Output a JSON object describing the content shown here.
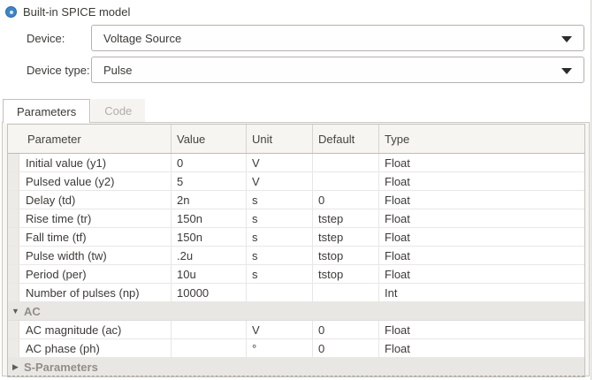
{
  "model_source": {
    "radio_label": "Built-in SPICE model",
    "selected": true
  },
  "fields": {
    "device": {
      "label": "Device:",
      "value": "Voltage Source"
    },
    "device_type": {
      "label": "Device type:",
      "value": "Pulse"
    }
  },
  "tabs": [
    {
      "label": "Parameters",
      "active": true
    },
    {
      "label": "Code",
      "active": false
    }
  ],
  "table": {
    "columns": [
      "Parameter",
      "Value",
      "Unit",
      "Default",
      "Type"
    ],
    "rows": [
      {
        "kind": "param",
        "parameter": "Initial value (y1)",
        "value": "0",
        "unit": "V",
        "default": "",
        "type": "Float"
      },
      {
        "kind": "param",
        "parameter": "Pulsed value (y2)",
        "value": "5",
        "unit": "V",
        "default": "",
        "type": "Float"
      },
      {
        "kind": "param",
        "parameter": "Delay (td)",
        "value": "2n",
        "unit": "s",
        "default": "0",
        "type": "Float"
      },
      {
        "kind": "param",
        "parameter": "Rise time (tr)",
        "value": "150n",
        "unit": "s",
        "default": "tstep",
        "type": "Float"
      },
      {
        "kind": "param",
        "parameter": "Fall time (tf)",
        "value": "150n",
        "unit": "s",
        "default": "tstep",
        "type": "Float"
      },
      {
        "kind": "param",
        "parameter": "Pulse width (tw)",
        "value": ".2u",
        "unit": "s",
        "default": "tstop",
        "type": "Float"
      },
      {
        "kind": "param",
        "parameter": "Period (per)",
        "value": "10u",
        "unit": "s",
        "default": "tstop",
        "type": "Float"
      },
      {
        "kind": "param",
        "parameter": "Number of pulses (np)",
        "value": "10000",
        "unit": "",
        "default": "",
        "type": "Int"
      },
      {
        "kind": "group",
        "parameter": "AC",
        "expanded": true
      },
      {
        "kind": "param",
        "parameter": "AC magnitude (ac)",
        "value": "",
        "unit": "V",
        "default": "0",
        "type": "Float"
      },
      {
        "kind": "param",
        "parameter": "AC phase (ph)",
        "value": "",
        "unit": "°",
        "default": "0",
        "type": "Float"
      },
      {
        "kind": "group",
        "parameter": "S-Parameters",
        "expanded": false
      }
    ]
  },
  "icons": {
    "radio_selected": "radio-selected-icon",
    "dropdown": "chevron-down-icon",
    "group_expanded": "▼",
    "group_collapsed": "▶"
  },
  "colors": {
    "accent_blue": "#3d85c6",
    "group_row_bg": "#e9e7e3",
    "header_bg": "#f6f5f2",
    "panel_bg": "#f7f6f3",
    "border": "#c5c2be"
  }
}
